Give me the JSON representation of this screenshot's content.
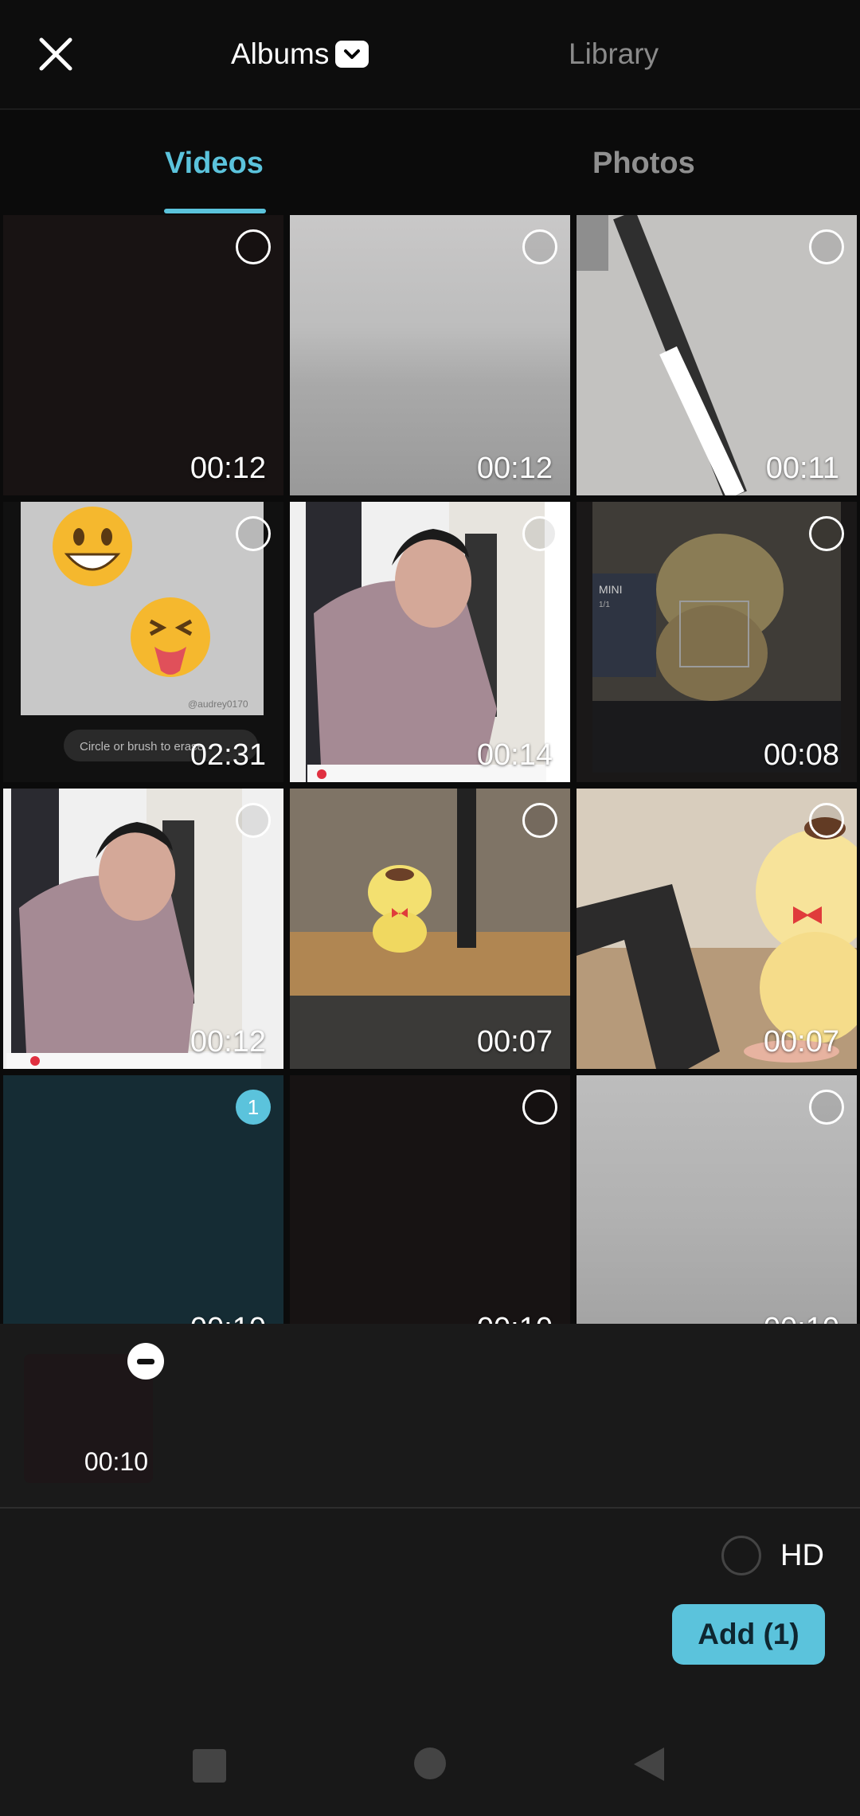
{
  "header": {
    "albums_label": "Albums",
    "library_label": "Library",
    "close_icon": "close-icon",
    "dropdown_icon": "chevron-down-icon"
  },
  "tabs": [
    {
      "label": "Videos",
      "active": true
    },
    {
      "label": "Photos",
      "active": false
    }
  ],
  "accent_color": "#5bc3dc",
  "media": [
    {
      "duration": "00:12",
      "selected": false
    },
    {
      "duration": "00:12",
      "selected": false
    },
    {
      "duration": "00:11",
      "selected": false
    },
    {
      "duration": "02:31",
      "selected": false
    },
    {
      "duration": "00:14",
      "selected": false
    },
    {
      "duration": "00:08",
      "selected": false
    },
    {
      "duration": "00:12",
      "selected": false
    },
    {
      "duration": "00:07",
      "selected": false
    },
    {
      "duration": "00:07",
      "selected": false
    },
    {
      "duration": "00:10",
      "selected": true,
      "order": "1"
    },
    {
      "duration": "00:10",
      "selected": false
    },
    {
      "duration": "00:10",
      "selected": false
    }
  ],
  "thumb_texts": {
    "caption": "Circle or brush to erase",
    "watermark": "@audrey0170",
    "tag": "MINI",
    "tag_sub": "1/1"
  },
  "tray": {
    "items": [
      {
        "duration": "00:10"
      }
    ]
  },
  "footer": {
    "hd_label": "HD",
    "add_label": "Add (1)"
  }
}
